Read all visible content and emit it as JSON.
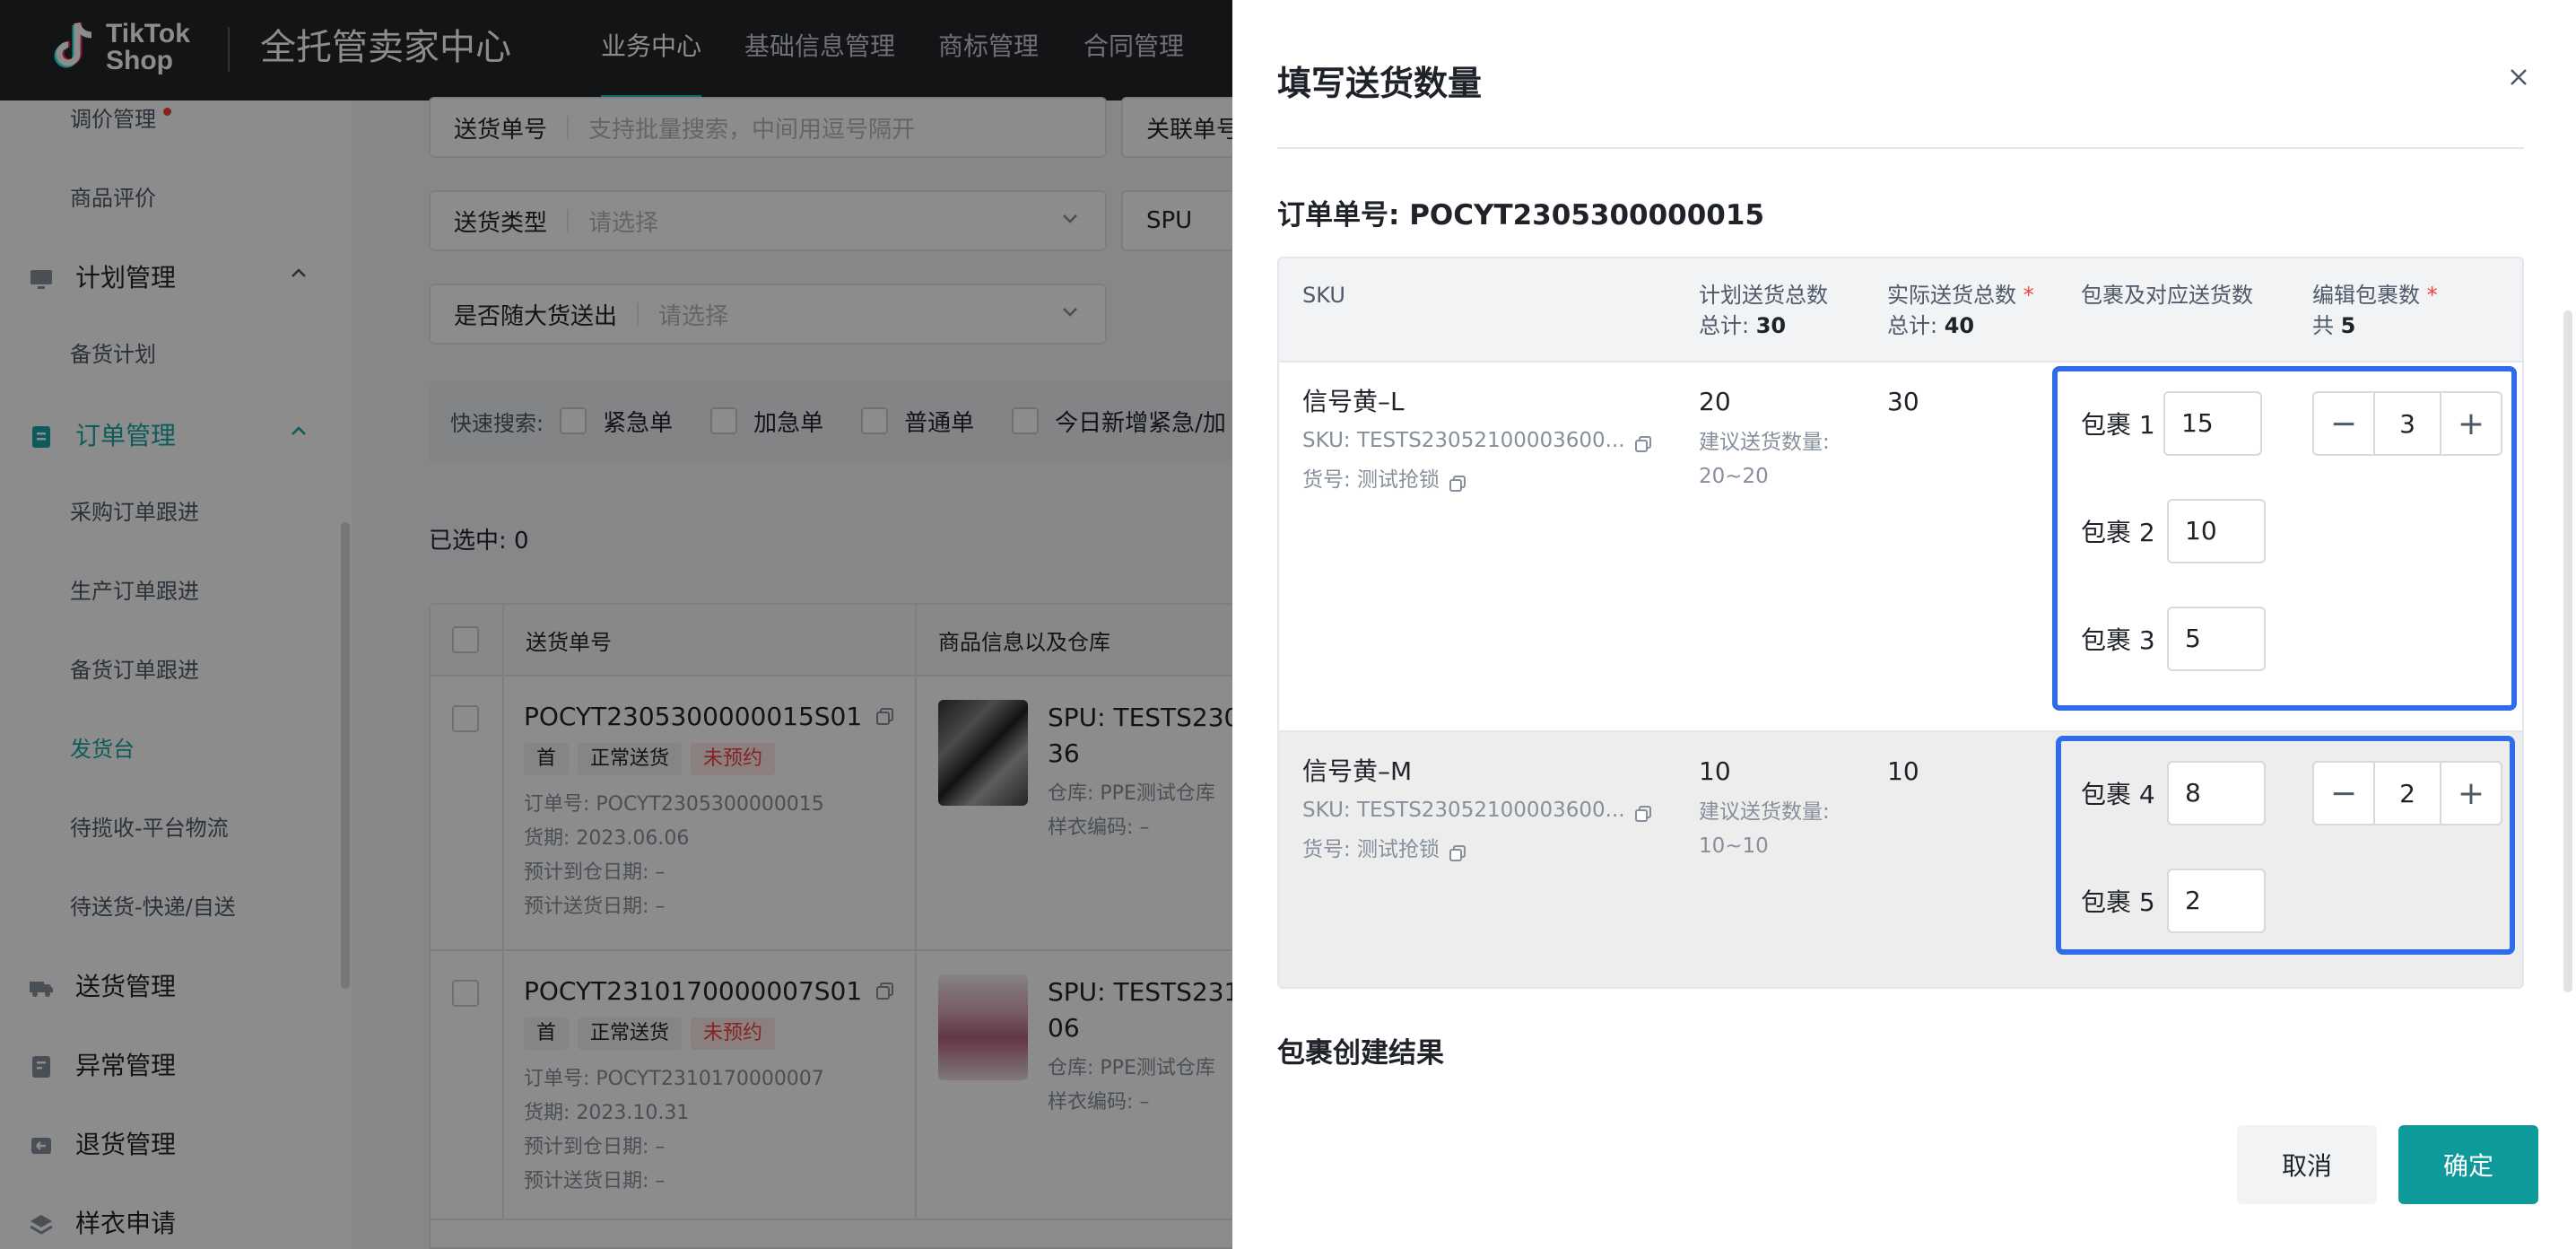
{
  "brand": {
    "logo_line1": "TikTok",
    "logo_line2": "Shop",
    "app_title": "全托管卖家中心"
  },
  "topnav": {
    "tabs": [
      {
        "label": "业务中心",
        "active": true
      },
      {
        "label": "基础信息管理",
        "active": false
      },
      {
        "label": "商标管理",
        "active": false
      },
      {
        "label": "合同管理",
        "active": false
      }
    ]
  },
  "sidebar": {
    "items": [
      {
        "label": "调价管理",
        "type": "item",
        "badge": "red-dot"
      },
      {
        "label": "商品评价",
        "type": "item"
      },
      {
        "label": "计划管理",
        "type": "group",
        "icon": "monitor-icon",
        "expanded": true
      },
      {
        "label": "备货计划",
        "type": "item"
      },
      {
        "label": "订单管理",
        "type": "group",
        "icon": "document-icon",
        "expanded": true,
        "active": true
      },
      {
        "label": "采购订单跟进",
        "type": "item"
      },
      {
        "label": "生产订单跟进",
        "type": "item"
      },
      {
        "label": "备货订单跟进",
        "type": "item"
      },
      {
        "label": "发货台",
        "type": "item",
        "active": true
      },
      {
        "label": "待揽收-平台物流",
        "type": "item"
      },
      {
        "label": "待送货-快递/自送",
        "type": "item"
      },
      {
        "label": "送货管理",
        "type": "group",
        "icon": "truck-icon"
      },
      {
        "label": "异常管理",
        "type": "group",
        "icon": "alert-doc-icon"
      },
      {
        "label": "退货管理",
        "type": "group",
        "icon": "return-icon"
      },
      {
        "label": "样衣申请",
        "type": "group",
        "icon": "layers-icon"
      }
    ]
  },
  "filters": {
    "delivery_no": {
      "label": "送货单号",
      "placeholder": "支持批量搜索，中间用逗号隔开"
    },
    "related_no": {
      "label": "关联单号"
    },
    "delivery_type": {
      "label": "送货类型",
      "placeholder": "请选择"
    },
    "spu": {
      "label": "SPU"
    },
    "with_goods": {
      "label": "是否随大货送出",
      "placeholder": "请选择"
    }
  },
  "quick_search": {
    "label": "快速搜索:",
    "options": [
      "紧急单",
      "加急单",
      "普通单",
      "今日新增紧急/加"
    ]
  },
  "selected": "已选中: 0",
  "table": {
    "headers": [
      "送货单号",
      "商品信息以及仓库"
    ],
    "rows": [
      {
        "delivery_no": "POCYT2305300000015S01",
        "tags": [
          "首",
          "正常送货",
          "未预约"
        ],
        "order_no": "订单号: POCYT2305300000015",
        "due": "货期: 2023.06.06",
        "arrive": "预计到仓日期: –",
        "ship": "预计送货日期: –",
        "spu_line1": "SPU: TESTS230",
        "spu_line2": "36",
        "warehouse": "仓库: PPE测试仓库",
        "sample": "样衣编码: –"
      },
      {
        "delivery_no": "POCYT2310170000007S01",
        "tags": [
          "首",
          "正常送货",
          "未预约"
        ],
        "order_no": "订单号: POCYT2310170000007",
        "due": "货期: 2023.10.31",
        "arrive": "预计到仓日期: –",
        "ship": "预计送货日期: –",
        "spu_line1": "SPU: TESTS231",
        "spu_line2": "06",
        "warehouse": "仓库: PPE测试仓库",
        "sample": "样衣编码: –"
      }
    ]
  },
  "drawer": {
    "title": "填写送货数量",
    "order_label": "订单单号: POCYT2305300000015",
    "columns": {
      "sku": "SKU",
      "planned": "计划送货总数",
      "planned_total_label": "总计:",
      "planned_total": "30",
      "actual": "实际送货总数",
      "actual_total_label": "总计:",
      "actual_total": "40",
      "packages": "包裹及对应送货数",
      "edit_count": "编辑包裹数",
      "edit_total_label": "共",
      "edit_total": "5",
      "required_mark": "*"
    },
    "rows": [
      {
        "name": "信号黄–L",
        "sku": "SKU: TESTS23052100003600...",
        "item_no": "货号: 测试抢锁",
        "planned": "20",
        "suggest_label": "建议送货数量:",
        "suggest_range": "20~20",
        "actual": "30",
        "packages": [
          {
            "label": "包裹 1",
            "value": "15"
          },
          {
            "label": "包裹 2",
            "value": "10"
          },
          {
            "label": "包裹 3",
            "value": "5"
          }
        ],
        "package_count": "3"
      },
      {
        "name": "信号黄–M",
        "sku": "SKU: TESTS23052100003600...",
        "item_no": "货号: 测试抢锁",
        "planned": "10",
        "suggest_label": "建议送货数量:",
        "suggest_range": "10~10",
        "actual": "10",
        "packages": [
          {
            "label": "包裹 4",
            "value": "8"
          },
          {
            "label": "包裹 5",
            "value": "2"
          }
        ],
        "package_count": "2"
      }
    ],
    "result_title": "包裹创建结果",
    "cancel_label": "取消",
    "confirm_label": "确定"
  },
  "colors": {
    "teal_accent": "#1aa6a6",
    "confirm_button": "#0e9a9a",
    "highlight_border": "#2f6ce8",
    "danger": "#f53f3f"
  }
}
